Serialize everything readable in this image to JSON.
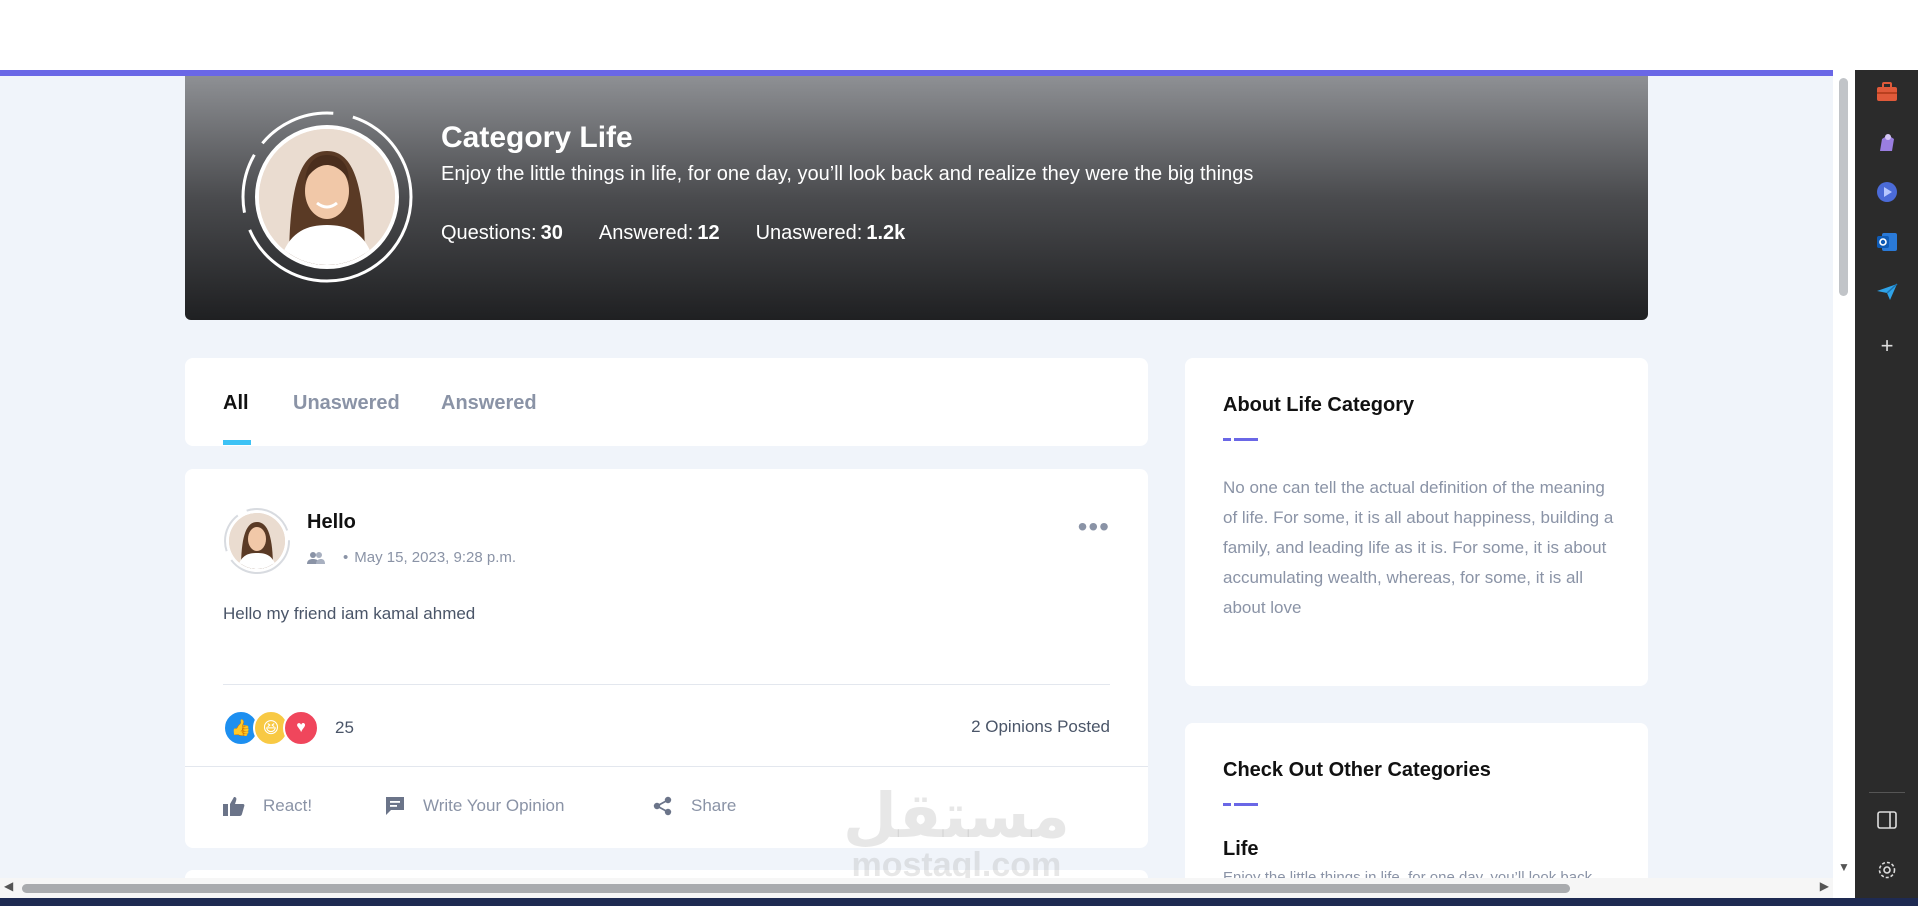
{
  "hero": {
    "title": "Category Life",
    "subtitle": "Enjoy the little things in life, for one day, you’ll look back and realize they were the big things",
    "stats": [
      {
        "label": "Questions:",
        "value": "30"
      },
      {
        "label": "Answered:",
        "value": "12"
      },
      {
        "label": "Unaswered:",
        "value": "1.2k"
      }
    ]
  },
  "tabs": [
    {
      "label": "All"
    },
    {
      "label": "Unaswered"
    },
    {
      "label": "Answered"
    }
  ],
  "post": {
    "author": "Hello",
    "date": "May 15, 2023, 9:28 p.m.",
    "body": "Hello my friend iam kamal ahmed",
    "reaction_count": "25",
    "opinions": "2 Opinions Posted",
    "actions": {
      "react": "React!",
      "opinion": "Write Your Opinion",
      "share": "Share"
    }
  },
  "about": {
    "title": "About Life Category",
    "text": "No one can tell the actual definition of the meaning of life. For some, it is all about happiness, building a family, and leading life as it is. For some, it is about accumulating wealth, whereas, for some, it is all about love"
  },
  "categories": {
    "title": "Check Out Other Categories",
    "items": [
      {
        "name": "Life",
        "desc": "Enjoy the little things in life, for one day, you’ll look back"
      }
    ]
  },
  "watermark": {
    "arabic": "مستقل",
    "latin": "mostaql.com"
  },
  "colors": {
    "accent": "#6a67e6",
    "tab_underline": "#3dc2f5",
    "page_bg": "#f0f4fa"
  }
}
